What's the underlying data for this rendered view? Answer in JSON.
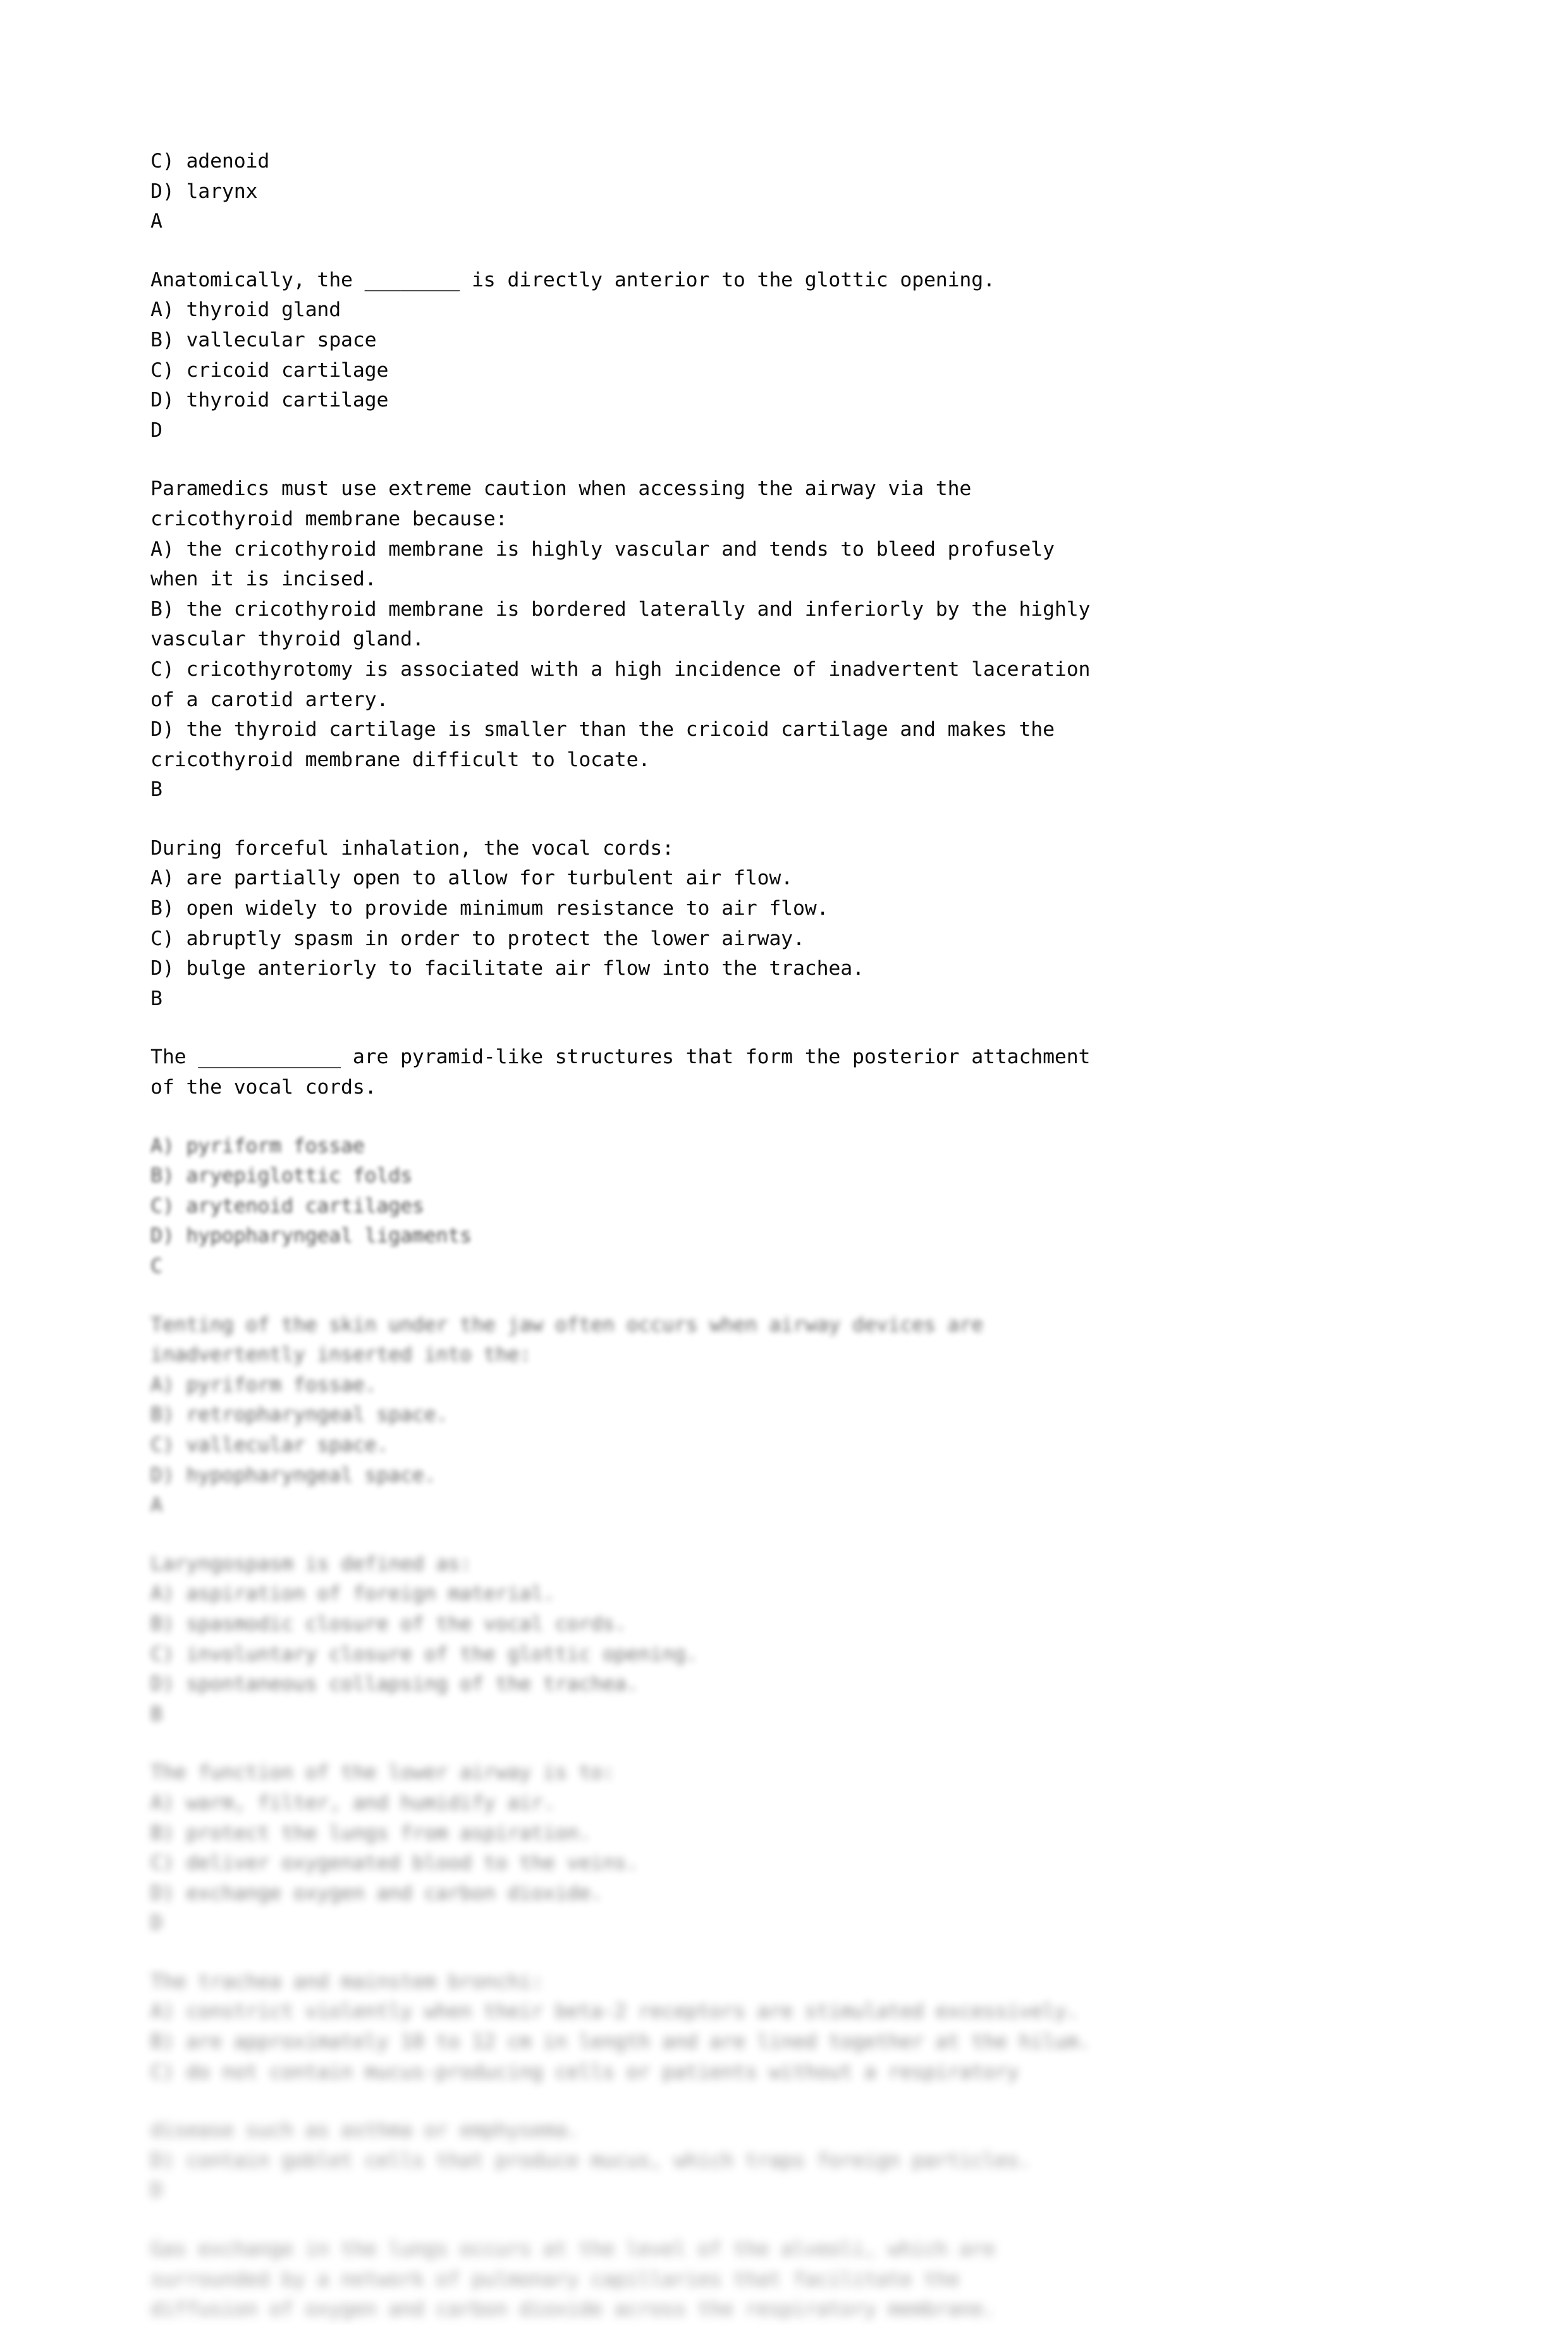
{
  "document": {
    "page_background": "#ffffff",
    "text_color": "#0a0a0a",
    "blocks": [
      {
        "id": "q-nasopharynx-tail",
        "blur": "b0",
        "lines": [
          "C) adenoid",
          "D) larynx",
          "A"
        ]
      },
      {
        "id": "q-glottic-opening",
        "blur": "b0",
        "lines": [
          "Anatomically, the ________ is directly anterior to the glottic opening.",
          "A) thyroid gland",
          "B) vallecular space",
          "C) cricoid cartilage",
          "D) thyroid cartilage",
          "D"
        ]
      },
      {
        "id": "q-cricothyroid-membrane",
        "blur": "b0",
        "lines": [
          "Paramedics must use extreme caution when accessing the airway via the",
          "cricothyroid membrane because:",
          "A) the cricothyroid membrane is highly vascular and tends to bleed profusely",
          "when it is incised.",
          "B) the cricothyroid membrane is bordered laterally and inferiorly by the highly",
          "vascular thyroid gland.",
          "C) cricothyrotomy is associated with a high incidence of inadvertent laceration",
          "of a carotid artery.",
          "D) the thyroid cartilage is smaller than the cricoid cartilage and makes the",
          "cricothyroid membrane difficult to locate.",
          "B"
        ]
      },
      {
        "id": "q-forceful-inhalation",
        "blur": "b0",
        "lines": [
          "During forceful inhalation, the vocal cords:",
          "A) are partially open to allow for turbulent air flow.",
          "B) open widely to provide minimum resistance to air flow.",
          "C) abruptly spasm in order to protect the lower airway.",
          "D) bulge anteriorly to facilitate air flow into the trachea.",
          "B"
        ]
      },
      {
        "id": "q-arytenoid-cartilages",
        "blur": "b0",
        "lines": [
          "The ____________ are pyramid-like structures that form the posterior attachment",
          "of the vocal cords."
        ]
      },
      {
        "id": "q-arytenoid-cartilages-options",
        "blur": "b1",
        "lines": [
          "A) pyriform fossae",
          "B) aryepiglottic folds",
          "C) arytenoid cartilages",
          "D) hypopharyngeal ligaments",
          "C"
        ]
      },
      {
        "id": "q-skin-under-jaw",
        "blur": "b2",
        "lines": [
          "Tenting of the skin under the jaw often occurs when airway devices are",
          "inadvertently inserted into the:",
          "A) pyriform fossae.",
          "B) retropharyngeal space.",
          "C) vallecular space.",
          "D) hypopharyngeal space.",
          "A"
        ]
      },
      {
        "id": "q-laryngospasm",
        "blur": "b3",
        "lines": [
          "Laryngospasm is defined as:",
          "A) aspiration of foreign material.",
          "B) spasmodic closure of the vocal cords.",
          "C) involuntary closure of the glottic opening.",
          "D) spontaneous collapsing of the trachea.",
          "B"
        ]
      },
      {
        "id": "q-lower-airway-function",
        "blur": "b4",
        "lines": [
          "The function of the lower airway is to:",
          "A) warm, filter, and humidify air.",
          "B) protect the lungs from aspiration.",
          "C) deliver oxygenated blood to the veins.",
          "D) exchange oxygen and carbon dioxide.",
          "D"
        ]
      },
      {
        "id": "q-trachea-mainstem-bronchi",
        "blur": "b5",
        "lines": [
          "The trachea and mainstem bronchi:",
          "A) constrict violently when their beta-2 receptors are stimulated excessively.",
          "B) are approximately 10 to 12 cm in length and are lined together at the hilum.",
          "C) do not contain mucus-producing cells or patients without a respiratory"
        ]
      },
      {
        "id": "q-trachea-mainstem-bronchi-tail",
        "blur": "b6",
        "lines": [
          "disease such as asthma or emphysema.",
          "D) contain goblet cells that produce mucus, which traps foreign particles.",
          "D"
        ]
      },
      {
        "id": "q-gas-exchange",
        "blur": "b7",
        "lines": [
          "Gas exchange in the lungs occurs at the level of the alveoli, which are",
          "surrounded by a network of pulmonary capillaries that facilitate the",
          "diffusion of oxygen and carbon dioxide across the respiratory membrane."
        ]
      }
    ]
  }
}
